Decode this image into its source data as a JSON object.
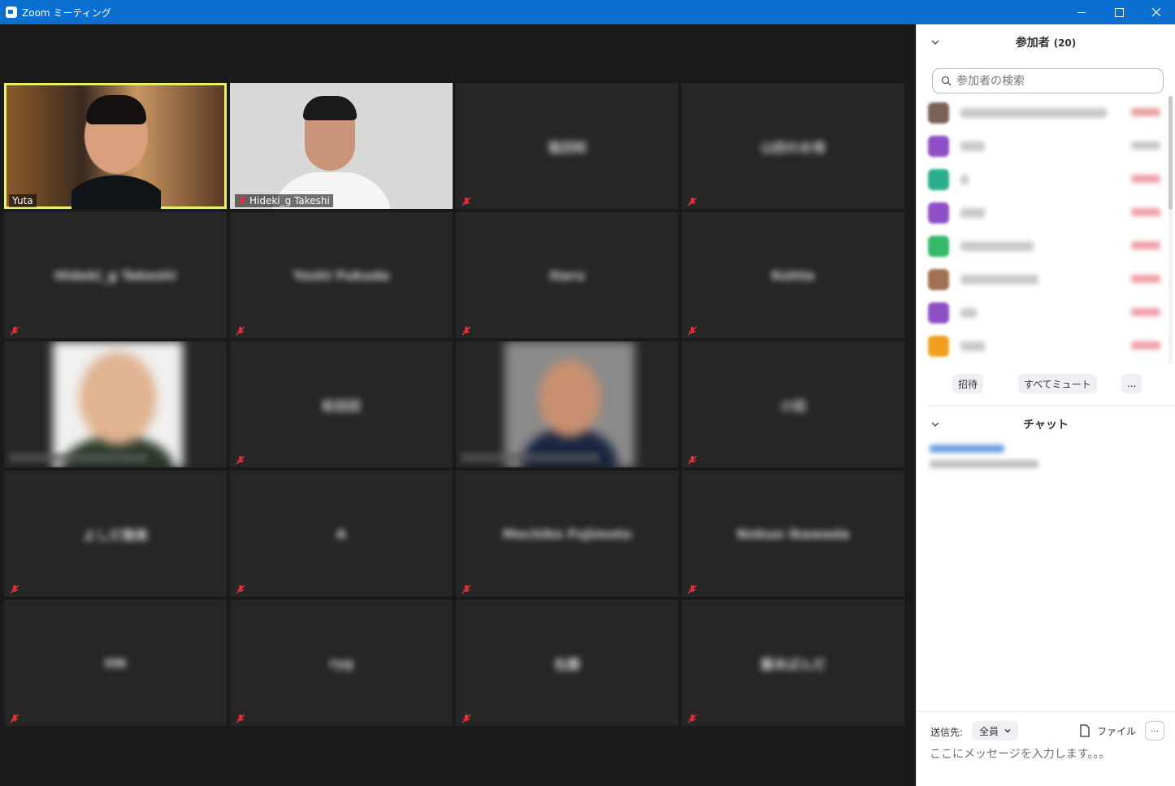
{
  "window": {
    "title": "Zoom ミーティング",
    "icon": "zoom-camera-icon"
  },
  "tiles": [
    {
      "label": "Yuta",
      "type": "video-yuta"
    },
    {
      "label": "Hideki_g Takeshi",
      "type": "video-hideki"
    },
    {
      "name": "塩田知",
      "type": "name"
    },
    {
      "name": "山田のお母",
      "type": "name"
    },
    {
      "name": "Hideki_g Takeshi",
      "type": "name"
    },
    {
      "name": "Yoshi Fukuda",
      "type": "name"
    },
    {
      "name": "Itaru",
      "type": "name"
    },
    {
      "name": "Kohta",
      "type": "name"
    },
    {
      "type": "photo-cartoon"
    },
    {
      "name": "松田田",
      "type": "name"
    },
    {
      "type": "photo-man"
    },
    {
      "name": "小田",
      "type": "name"
    },
    {
      "name": "よしだ雅美",
      "type": "name"
    },
    {
      "name": "A",
      "type": "name"
    },
    {
      "name": "Mochiko Fujimoto",
      "type": "name"
    },
    {
      "name": "Nobuo Ikawada",
      "type": "name"
    },
    {
      "name": "HN",
      "type": "name"
    },
    {
      "name": "ryg",
      "type": "name"
    },
    {
      "name": "佐藤",
      "type": "name"
    },
    {
      "name": "藤本ぱんだ",
      "type": "name"
    }
  ],
  "participants": {
    "title": "参加者",
    "count": "(20)",
    "search_placeholder": "参加者の検索",
    "list": [
      {
        "color": "#7a6258",
        "w": 180,
        "ic": "#e9a0a0"
      },
      {
        "color": "#8e4fc4",
        "w": 30,
        "ic": "#c8c8c8"
      },
      {
        "color": "#2bae8c",
        "w": 10,
        "ic": "#f0a0a8"
      },
      {
        "color": "#8e4fc4",
        "w": 30,
        "ic": "#f0a0a8"
      },
      {
        "color": "#35b86a",
        "w": 90,
        "ic": "#f0a0a8"
      },
      {
        "color": "#a07050",
        "w": 96,
        "ic": "#f0a0a8"
      },
      {
        "color": "#8e4fc4",
        "w": 20,
        "ic": "#f0a0a8"
      },
      {
        "color": "#f0a020",
        "w": 30,
        "ic": "#f0a0a8"
      }
    ],
    "buttons": {
      "invite": "招待",
      "mute_all": "すべてミュート",
      "more": "..."
    }
  },
  "chat": {
    "title": "チャット",
    "to_label": "送信先:",
    "to_value": "全員",
    "file_label": "ファイル",
    "more": "···",
    "input_placeholder": "ここにメッセージを入力します。。。"
  }
}
